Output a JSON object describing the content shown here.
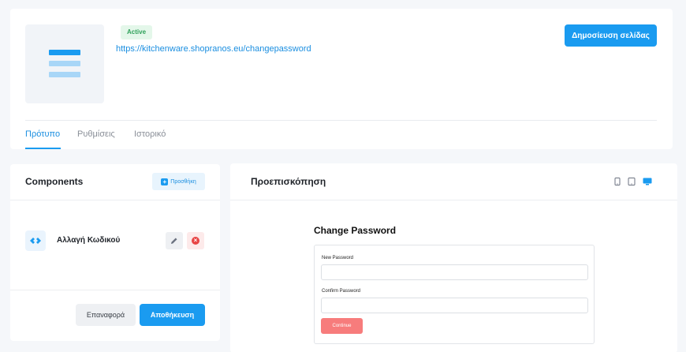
{
  "page": {
    "status": "Active",
    "url": "https://kitchenware.shopranos.eu/changepassword",
    "publish_label": "Δημοσίευση σελίδας",
    "tabs": [
      {
        "label": "Πρότυπο"
      },
      {
        "label": "Ρυθμίσεις"
      },
      {
        "label": "Ιστορικό"
      }
    ]
  },
  "components": {
    "title": "Components",
    "add_label": "Προσθήκη",
    "items": [
      {
        "name": "Αλλαγή Κωδικού"
      }
    ],
    "reset_label": "Επαναφορά",
    "save_label": "Αποθήκευση"
  },
  "preview": {
    "title": "Προεπισκόπηση",
    "devices": [
      "mobile-icon",
      "tablet-icon",
      "desktop-icon"
    ],
    "active_device": "desktop-icon",
    "form": {
      "title": "Change Password",
      "new_password_label": "New Password",
      "confirm_password_label": "Confirm Password",
      "continue_label": "Continue"
    }
  },
  "colors": {
    "accent": "#1a9bf0",
    "status_bg": "#e4f7ea",
    "status_text": "#2fa15a",
    "danger": "#e84545",
    "continue_button": "#f77c7c"
  }
}
